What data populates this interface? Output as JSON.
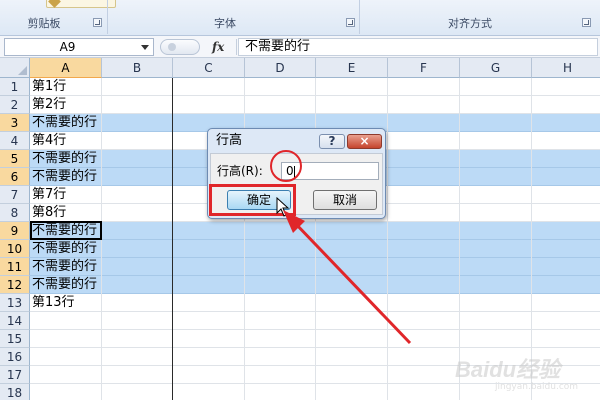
{
  "ribbon": {
    "groups": [
      {
        "label": "剪贴板"
      },
      {
        "label": "字体"
      },
      {
        "label": "对齐方式"
      }
    ]
  },
  "formula_bar": {
    "name_box": "A9",
    "fx_label": "fx",
    "formula": "不需要的行"
  },
  "sheet": {
    "columns": [
      "A",
      "B",
      "C",
      "D",
      "E",
      "F",
      "G",
      "H"
    ],
    "rows": [
      {
        "num": "1",
        "a": "第1行",
        "highlight": false
      },
      {
        "num": "2",
        "a": "第2行",
        "highlight": false
      },
      {
        "num": "3",
        "a": "不需要的行",
        "highlight": true
      },
      {
        "num": "4",
        "a": "第4行",
        "highlight": false
      },
      {
        "num": "5",
        "a": "不需要的行",
        "highlight": true
      },
      {
        "num": "6",
        "a": "不需要的行",
        "highlight": true
      },
      {
        "num": "7",
        "a": "第7行",
        "highlight": false
      },
      {
        "num": "8",
        "a": "第8行",
        "highlight": false
      },
      {
        "num": "9",
        "a": "不需要的行",
        "highlight": true
      },
      {
        "num": "10",
        "a": "不需要的行",
        "highlight": true
      },
      {
        "num": "11",
        "a": "不需要的行",
        "highlight": true
      },
      {
        "num": "12",
        "a": "不需要的行",
        "highlight": true
      },
      {
        "num": "13",
        "a": "第13行",
        "highlight": false
      },
      {
        "num": "14",
        "a": "",
        "highlight": false
      },
      {
        "num": "15",
        "a": "",
        "highlight": false
      },
      {
        "num": "16",
        "a": "",
        "highlight": false
      },
      {
        "num": "17",
        "a": "",
        "highlight": false
      },
      {
        "num": "18",
        "a": "",
        "highlight": false
      }
    ]
  },
  "dialog": {
    "title": "行高",
    "help": "?",
    "close": "×",
    "label": "行高(R):",
    "value": "0",
    "ok": "确定",
    "cancel": "取消"
  },
  "watermark": {
    "main": "Baidu经验",
    "sub": "jingyan.baidu.com"
  },
  "colors": {
    "selection_fill": "#bcdaf6",
    "header_selected": "#f9d99f",
    "annotation_red": "#e0262a"
  }
}
